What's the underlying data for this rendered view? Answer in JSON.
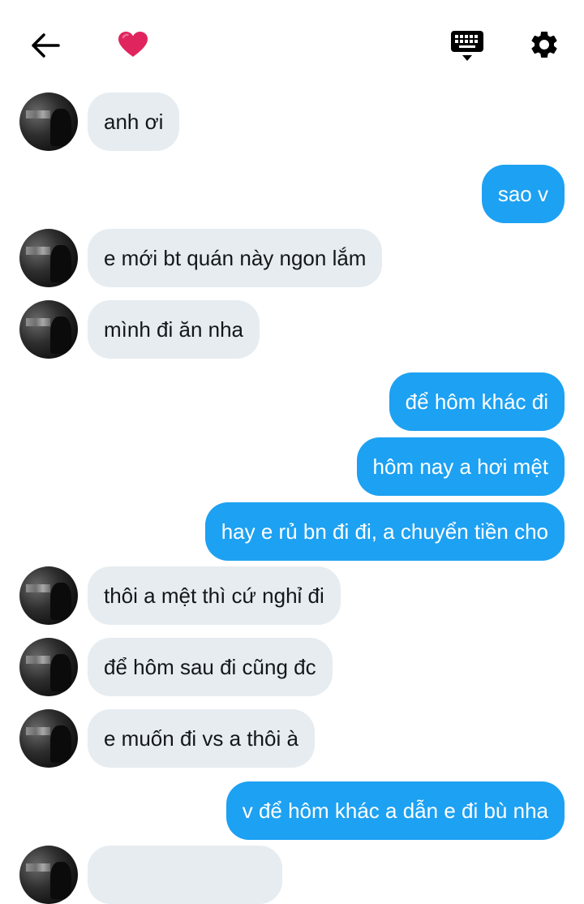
{
  "header": {
    "back_icon": "arrow-left-icon",
    "heart_icon": "red-heart-icon",
    "keyboard_icon": "keyboard-icon",
    "settings_icon": "gear-icon",
    "colors": {
      "icon": "#000000",
      "heart": "#e0245e"
    }
  },
  "colors": {
    "incoming_bubble": "#e6ecf0",
    "outgoing_bubble": "#1da1f2"
  },
  "messages": [
    {
      "dir": "in",
      "text": "anh ơi"
    },
    {
      "dir": "out",
      "text": "sao v"
    },
    {
      "dir": "in",
      "text": "e mới bt quán này ngon lắm"
    },
    {
      "dir": "in",
      "text": "mình đi ăn nha"
    },
    {
      "dir": "out",
      "text": "để hôm khác đi"
    },
    {
      "dir": "out",
      "text": "hôm nay a hơi mệt"
    },
    {
      "dir": "out",
      "text": "hay e rủ bn đi đi, a chuyển tiền cho"
    },
    {
      "dir": "in",
      "text": "thôi a mệt thì cứ nghỉ đi"
    },
    {
      "dir": "in",
      "text": "để hôm sau đi cũng đc"
    },
    {
      "dir": "in",
      "text": "e muốn đi vs a thôi à"
    },
    {
      "dir": "out",
      "text": "v để hôm khác a dẫn e đi bù nha"
    }
  ]
}
